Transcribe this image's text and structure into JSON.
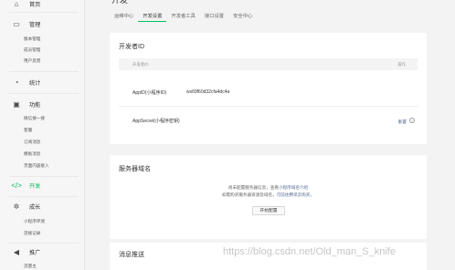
{
  "sidebar": {
    "home": {
      "icon": "home-icon",
      "label": "首页"
    },
    "manage": {
      "icon": "folder-icon",
      "label": "管理",
      "items": [
        "版本管理",
        "成员管理",
        "用户反馈"
      ]
    },
    "stats": {
      "icon": "chart-icon",
      "label": "统计"
    },
    "features": {
      "icon": "cube-icon",
      "label": "功能",
      "items": [
        "微信搜一搜",
        "客服",
        "订阅消息",
        "模板消息",
        "页面内容接入"
      ]
    },
    "develop": {
      "icon": "code-icon",
      "label": "开发"
    },
    "growth": {
      "icon": "growth-icon",
      "label": "成长",
      "items": [
        "小程序评测",
        "违规记录"
      ]
    },
    "promote": {
      "icon": "megaphone-icon",
      "label": "推广",
      "items": [
        "流量主"
      ]
    }
  },
  "header": {
    "title": "开发"
  },
  "tabs": [
    {
      "label": "运维中心",
      "active": false
    },
    {
      "label": "开发设置",
      "active": true
    },
    {
      "label": "开发者工具",
      "active": false
    },
    {
      "label": "接口设置",
      "active": false
    },
    {
      "label": "安全中心",
      "active": false
    }
  ],
  "developer_id": {
    "title": "开发者ID",
    "col_id": "开发者ID",
    "col_action": "操作",
    "appid_label": "AppID(小程序ID)",
    "appid_value": "wx69f60d32cfa4dc4a",
    "secret_label": "AppSecret(小程序密钥)",
    "reset_label": "重置",
    "help_icon": "?"
  },
  "server_domain": {
    "title": "服务器域名",
    "line1_prefix": "尚未配置服务器信息，查看",
    "line1_link": "小程序域名介绍",
    "line2_prefix": "如需购买服务器资源及域名，",
    "line2_link": "可前往腾讯云购买。",
    "config_button": "开始配置"
  },
  "message_push": {
    "title": "消息推送"
  },
  "watermark": "https://blog.csdn.net/Old_man_S_knife",
  "colors": {
    "accent": "#07c160",
    "link": "#576b95",
    "background": "#f3f3f3",
    "card": "#ffffff"
  }
}
